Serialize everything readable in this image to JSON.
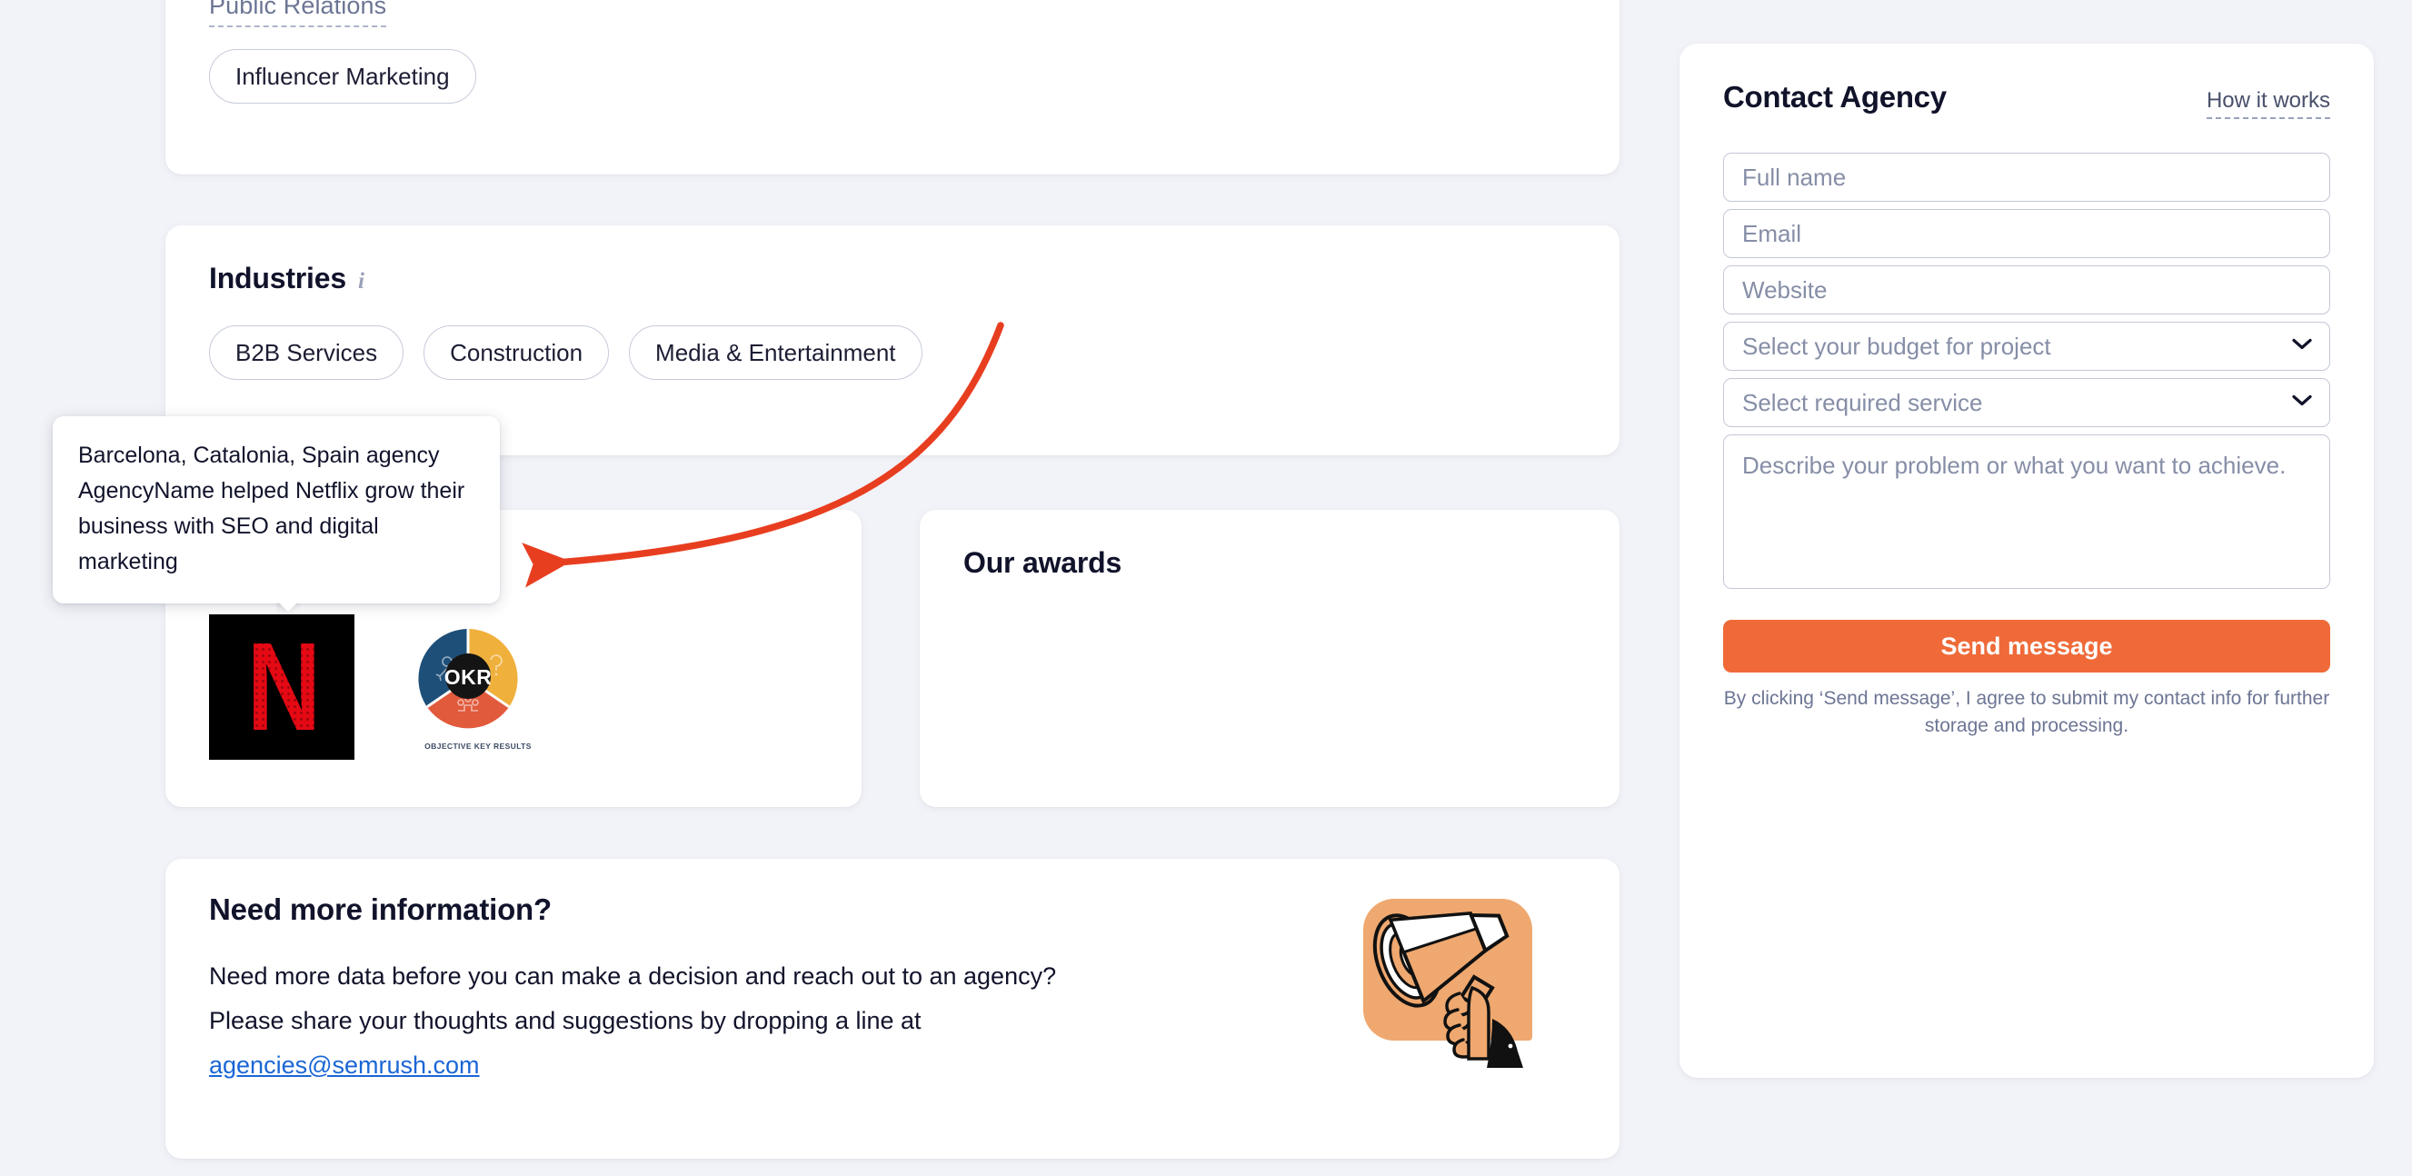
{
  "services_section": {
    "group_label": "Public Relations",
    "chips": [
      "Influencer Marketing"
    ]
  },
  "industries_section": {
    "heading": "Industries",
    "info_icon": "info-icon",
    "chips": [
      "B2B Services",
      "Construction",
      "Media & Entertainment"
    ]
  },
  "clients_section": {
    "logos": [
      {
        "name": "Netflix",
        "glyph": "N"
      },
      {
        "name": "OKR",
        "glyph": "OKR",
        "caption": "OBJECTIVE KEY RESULTS"
      }
    ]
  },
  "awards_section": {
    "heading": "Our awards"
  },
  "tooltip": {
    "text": "Barcelona, Catalonia, Spain agency AgencyName helped Netflix grow their business with SEO and digital marketing"
  },
  "info_section": {
    "title": "Need more information?",
    "body_line1": "Need more data before you can make a decision and reach out to an agency?",
    "body_line2": "Please share your thoughts and suggestions by dropping a line at",
    "email": "agencies@semrush.com",
    "illustration": "megaphone-illustration"
  },
  "contact_panel": {
    "title": "Contact Agency",
    "how_it_works": "How it works",
    "fields": {
      "full_name_placeholder": "Full name",
      "email_placeholder": "Email",
      "website_placeholder": "Website",
      "budget_placeholder": "Select your budget for project",
      "service_placeholder": "Select required service",
      "message_placeholder": "Describe your problem or what you want to achieve."
    },
    "send_label": "Send message",
    "consent": "By clicking ‘Send message’, I agree to submit my contact info for further storage and processing."
  },
  "annotation": {
    "arrow_color": "#e83e20"
  },
  "colors": {
    "page_background": "#f2f3f8",
    "card_background": "#ffffff",
    "accent_orange": "#ef6a38",
    "link_blue": "#1a66d6",
    "text_dark": "#11132b",
    "text_muted": "#6c7594",
    "chip_border": "#c7ccdb",
    "annotation_red": "#e83e20",
    "netflix_red": "#e50914"
  }
}
